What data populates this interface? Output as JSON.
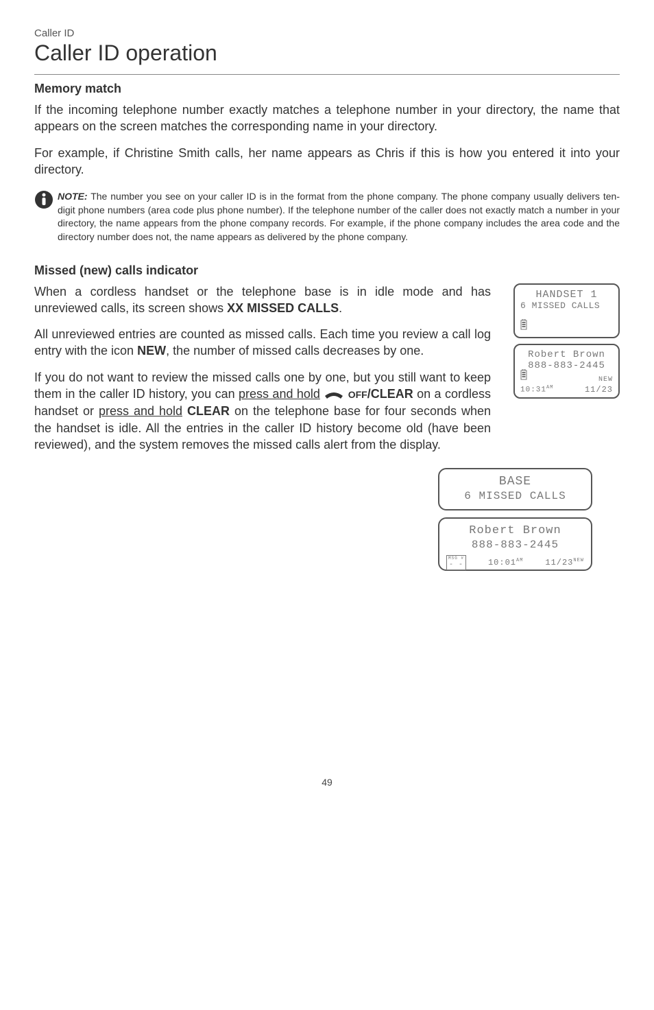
{
  "header": {
    "section_label": "Caller ID",
    "title": "Caller ID operation"
  },
  "memory_match": {
    "heading": "Memory match",
    "para1": "If the incoming telephone number exactly matches a telephone number in your directory, the name that appears on the screen matches the corresponding name in your directory.",
    "para2": "For example, if Christine Smith calls, her name appears as Chris if this is how you entered it into your directory."
  },
  "note": {
    "label": "NOTE:",
    "text": " The number you see on your caller ID is in the format from the phone company. The phone company usually delivers ten-digit phone numbers (area code plus phone number). If the telephone number of the caller does not exactly match a number in your directory, the name appears from the phone company records. For example, if the phone company includes the area code and the directory number does not, the name appears as delivered by the phone company."
  },
  "missed": {
    "heading": "Missed (new) calls indicator",
    "para1_a": "When a cordless handset or the telephone base is in idle mode and has unreviewed calls, its screen shows ",
    "para1_b": "XX MISSED CALLS",
    "para1_c": ".",
    "para2_a": "All unreviewed entries are counted as missed calls. Each time you review a call log entry with the icon ",
    "para2_b": "NEW",
    "para2_c": ", the number of missed calls decreases by one.",
    "para3_a": "If you do not want to review the missed calls one by one, but you still want to keep them in the caller ID history, you can ",
    "para3_hold1": "press and hold",
    "para3_b": " ",
    "para3_off": "OFF",
    "para3_clear": "/CLEAR",
    "para3_c": " on a cordless handset or ",
    "para3_hold2": "press and hold",
    "para3_d": " ",
    "para3_clear2": "CLEAR",
    "para3_e": " on the telephone base for four seconds when the handset is idle. All the entries in the caller ID history become old (have been reviewed), and the system removes the missed calls alert from the display."
  },
  "screens": {
    "handset_idle": {
      "line1": "HANDSET 1",
      "line2": "6 MISSED CALLS"
    },
    "handset_detail": {
      "name": "Robert Brown",
      "number": "888-883-2445",
      "new": "NEW",
      "time": "10:31",
      "ampm": "AM",
      "date": "11/23"
    },
    "base_idle": {
      "line1": "BASE",
      "line2": "6 MISSED CALLS"
    },
    "base_detail": {
      "name": "Robert Brown",
      "number": "888-883-2445",
      "msg": "MSG #",
      "msgval": "- -",
      "time": "10:01",
      "ampm": "AM",
      "date": "11/23",
      "new": "NEW"
    }
  },
  "page_number": "49"
}
